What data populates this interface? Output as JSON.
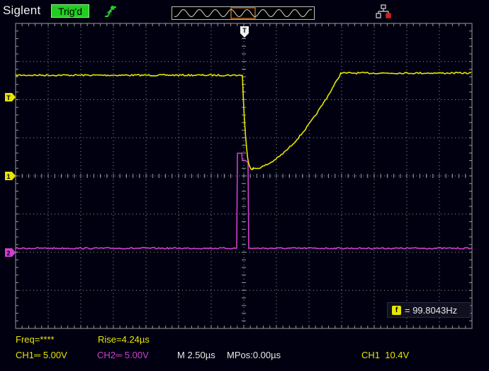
{
  "header": {
    "brand": "Siglent",
    "trigger_status": "Trig'd",
    "icons": [
      "rising-edge-icon",
      "memory-overview-icon",
      "network-icon"
    ]
  },
  "waveform": {
    "trigger_marker": "T",
    "trigger_level_marker": "T",
    "ch1_marker": "1",
    "ch2_marker": "2"
  },
  "frequency_counter": {
    "icon_label": "f",
    "value": "= 99.8043Hz"
  },
  "measurements": {
    "freq": "Freq=****",
    "rise": "Rise=4.24µs"
  },
  "status": {
    "ch1": "CH1═ 5.00V",
    "ch2": "CH2═ 5.00V",
    "timebase": "M 2.50µs",
    "mpos": "MPos:0.00µs",
    "trigger": "CH1  10.4V"
  },
  "colors": {
    "ch1": "#e6e600",
    "ch2": "#d040d0",
    "trig_status_bg": "#22cc22",
    "grid": "#9a9a9a",
    "background": "#000010"
  }
}
